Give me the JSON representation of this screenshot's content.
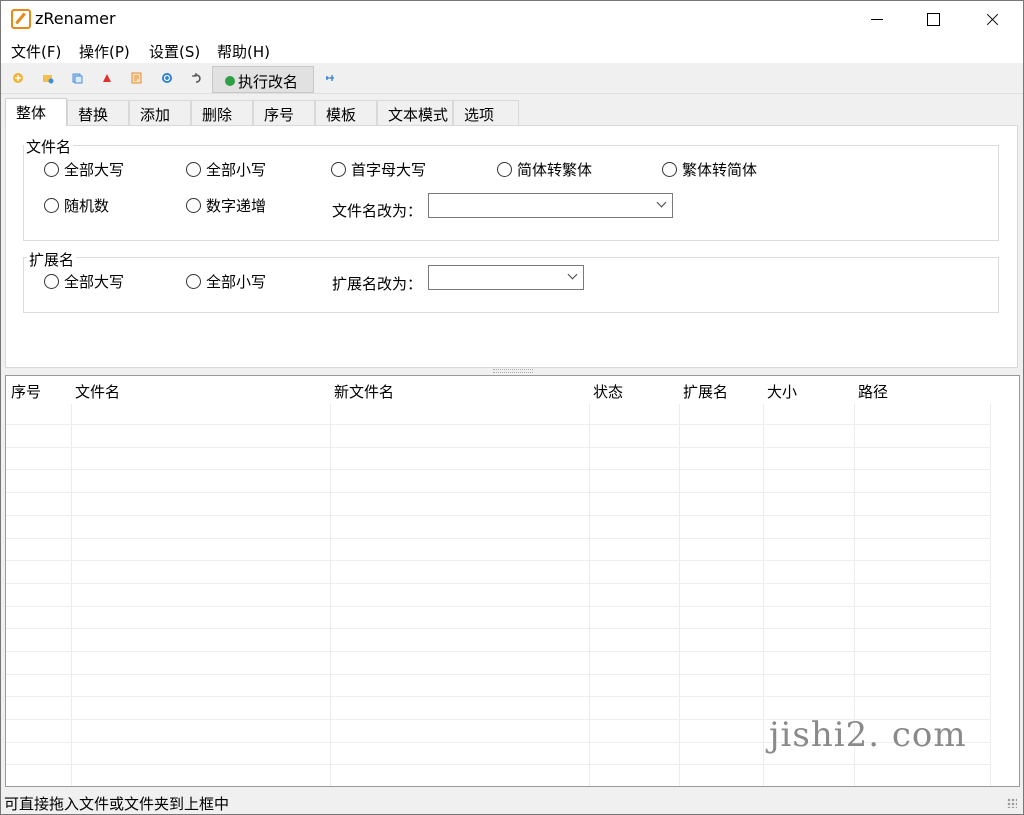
{
  "window": {
    "title": "zRenamer"
  },
  "menu": [
    "文件(F)",
    "操作(P)",
    "设置(S)",
    "帮助(H)"
  ],
  "toolbar": {
    "icons": [
      {
        "name": "add-file-icon",
        "color": "#f2b430"
      },
      {
        "name": "add-folder-icon",
        "color": "#f2b430"
      },
      {
        "name": "copy-icon",
        "color": "#4a8fd8"
      },
      {
        "name": "remove-icon",
        "color": "#e03030"
      },
      {
        "name": "edit-icon",
        "color": "#e88a30"
      },
      {
        "name": "refresh-icon",
        "color": "#2a7fd8"
      },
      {
        "name": "undo-icon",
        "color": "#555555"
      }
    ],
    "run_label": "执行改名",
    "pin_icon_color": "#2a7fd8"
  },
  "tabs": [
    "整体",
    "替换",
    "添加",
    "删除",
    "序号",
    "模板",
    "文本模式",
    "选项"
  ],
  "filename_group": {
    "label": "文件名",
    "row1": [
      "全部大写",
      "全部小写",
      "首字母大写",
      "简体转繁体",
      "繁体转简体"
    ],
    "row2": [
      "随机数",
      "数字递增"
    ],
    "rename_label": "文件名改为：",
    "rename_value": ""
  },
  "ext_group": {
    "label": "扩展名",
    "options": [
      "全部大写",
      "全部小写"
    ],
    "rename_label": "扩展名改为：",
    "rename_value": ""
  },
  "table": {
    "columns": [
      "序号",
      "文件名",
      "新文件名",
      "状态",
      "扩展名",
      "大小",
      "路径"
    ],
    "rows": []
  },
  "watermark": "jishi2. com",
  "status": "可直接拖入文件或文件夹到上框中"
}
